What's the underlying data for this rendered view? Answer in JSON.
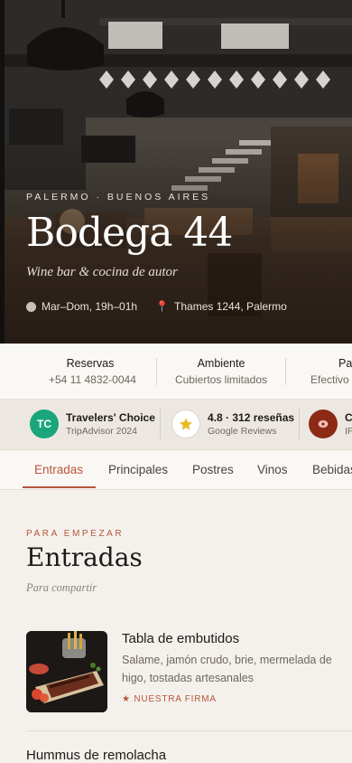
{
  "hero": {
    "kicker": "PALERMO · BUENOS AIRES",
    "title": "Bodega 44",
    "subtitle": "Wine bar & cocina de autor",
    "hours": "Mar–Dom, 19h–01h",
    "address": "Thames 1244, Palermo"
  },
  "info": [
    {
      "label": "Reservas",
      "value": "+54 11 4832-0044"
    },
    {
      "label": "Ambiente",
      "value": "Cubiertos limitados"
    },
    {
      "label": "Pa",
      "value": "Efectivo ·"
    }
  ],
  "badges": [
    {
      "logo": "TC",
      "title": "Travelers' Choice",
      "sub": "TripAdvisor 2024",
      "color": "#1aa67a"
    },
    {
      "logo": "star-icon",
      "title": "4.8 · 312 reseñas",
      "sub": "Google Reviews",
      "color": "#ffffff"
    },
    {
      "logo": "meat-icon",
      "title": "C",
      "sub": "IP",
      "color": "#8c2a16"
    }
  ],
  "tabs": [
    "Entradas",
    "Principales",
    "Postres",
    "Vinos",
    "Bebidas"
  ],
  "active_tab": "Entradas",
  "section": {
    "kicker": "PARA EMPEZAR",
    "title": "Entradas",
    "subtitle": "Para compartir"
  },
  "items": [
    {
      "name": "Tabla de embutidos",
      "description": "Salame, jamón crudo, brie, mermelada de higo, tostadas artesanales",
      "signature": "★ NUESTRA FIRMA"
    },
    {
      "name": "Hummus de remolacha"
    }
  ],
  "colors": {
    "accent": "#b8553a",
    "background": "#f4f1ec"
  }
}
